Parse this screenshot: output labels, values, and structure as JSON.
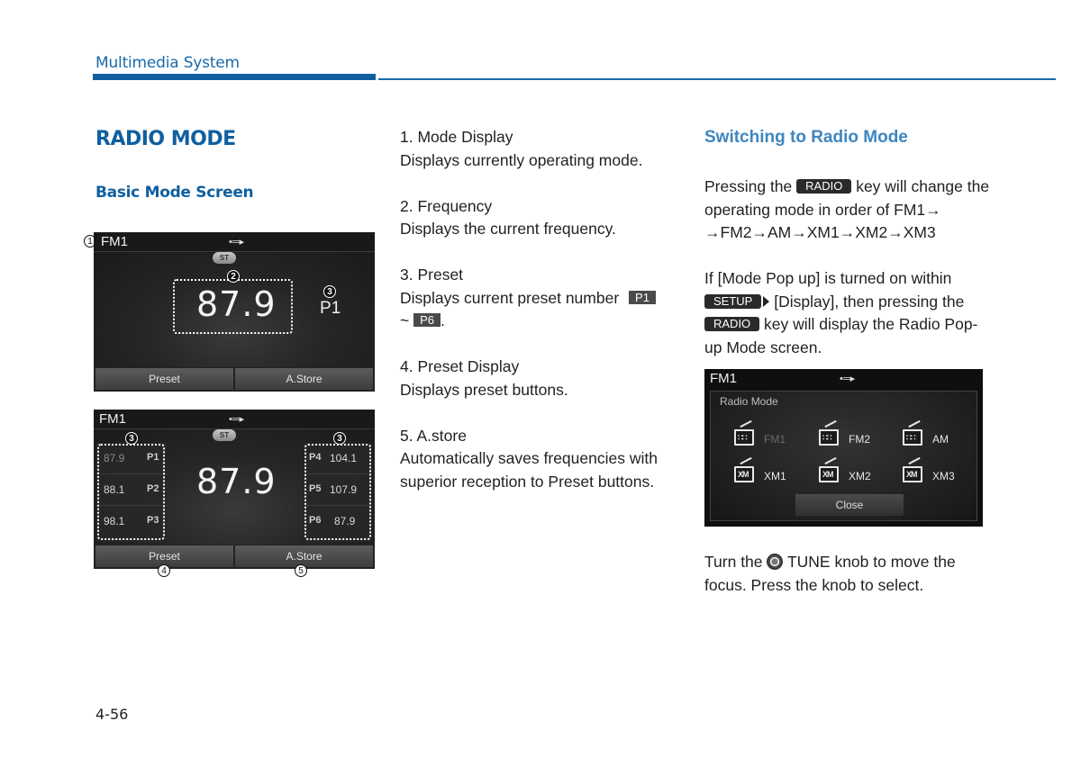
{
  "header": {
    "title": "Multimedia System"
  },
  "section": {
    "title": "RADIO MODE",
    "subtitle": "Basic Mode Screen"
  },
  "screen1": {
    "mode": "FM1",
    "usb_icon": "usb-icon",
    "st_badge": "ST",
    "frequency": "87.9",
    "preset": "P1",
    "buttons": [
      "Preset",
      "A.Store"
    ],
    "callouts": [
      "1",
      "2",
      "3"
    ]
  },
  "screen2": {
    "mode": "FM1",
    "st_badge": "ST",
    "frequency": "87.9",
    "presets_left": [
      {
        "freq": "87.9",
        "label": "P1"
      },
      {
        "freq": "88.1",
        "label": "P2"
      },
      {
        "freq": "98.1",
        "label": "P3"
      }
    ],
    "presets_right": [
      {
        "freq": "104.1",
        "label": "P4"
      },
      {
        "freq": "107.9",
        "label": "P5"
      },
      {
        "freq": "87.9",
        "label": "P6"
      }
    ],
    "buttons": [
      "Preset",
      "A.Store"
    ],
    "callouts": [
      "3",
      "3",
      "4",
      "5"
    ]
  },
  "descriptions": [
    {
      "title": "1. Mode Display",
      "text": "Displays currently operating mode."
    },
    {
      "title": "2. Frequency",
      "text": "Displays the current frequency."
    },
    {
      "title": "3. Preset",
      "text_before": "Displays current preset number",
      "tag1": "P1",
      "tilde": "~",
      "tag2": "P6",
      "text_after": "."
    },
    {
      "title": "4. Preset Display",
      "text": "Displays preset buttons."
    },
    {
      "title": "5. A.store",
      "text": "Automatically saves frequencies with superior reception to Preset buttons."
    }
  ],
  "switching": {
    "title": "Switching to Radio Mode",
    "para1_before": "Pressing the",
    "radio_key": "RADIO",
    "para1_after": "key will change the operating mode in order of FM1→",
    "para1_line3": "→FM2→AM→XM1→XM2→XM3",
    "para2_line1": "If [Mode Pop up] is turned on within",
    "setup_key": "SETUP",
    "para2_mid": "[Display], then pressing the",
    "para2_after": "key will display the Radio Pop-up Mode screen.",
    "para3_before": "Turn the",
    "para3_after": "TUNE knob to move the focus. Press the knob to select."
  },
  "popup": {
    "mode": "FM1",
    "title": "Radio Mode",
    "items": [
      {
        "label": "FM1",
        "icon": "fm-radio-icon",
        "dim": true
      },
      {
        "label": "FM2",
        "icon": "fm-radio-icon",
        "dim": false
      },
      {
        "label": "AM",
        "icon": "am-radio-icon",
        "dim": false
      },
      {
        "label": "XM1",
        "icon": "xm-radio-icon",
        "dim": false
      },
      {
        "label": "XM2",
        "icon": "xm-radio-icon",
        "dim": false
      },
      {
        "label": "XM3",
        "icon": "xm-radio-icon",
        "dim": false
      }
    ],
    "close_label": "Close"
  },
  "page_number": "4-56"
}
